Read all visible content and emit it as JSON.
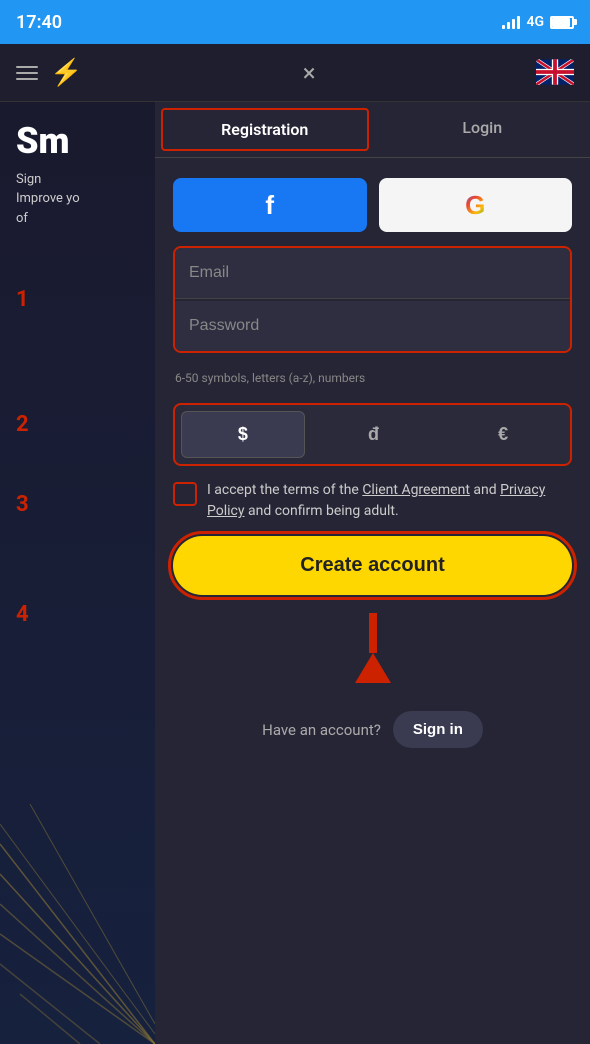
{
  "statusBar": {
    "time": "17:40",
    "network": "4G"
  },
  "navBar": {
    "closeLabel": "×"
  },
  "tabs": {
    "registration": "Registration",
    "login": "Login",
    "activeTab": "registration"
  },
  "social": {
    "facebookLabel": "f",
    "googleLabel": "G"
  },
  "form": {
    "emailPlaceholder": "Email",
    "passwordPlaceholder": "Password",
    "passwordHint": "6-50 symbols, letters (a-z), numbers"
  },
  "currencies": [
    {
      "symbol": "$",
      "active": true
    },
    {
      "symbol": "đ",
      "active": false
    },
    {
      "symbol": "€",
      "active": false
    }
  ],
  "terms": {
    "text1": "I accept the terms of the ",
    "link1": "Client Agreement",
    "text2": " and ",
    "link2": "Privacy Policy",
    "text3": " and confirm being adult."
  },
  "createButton": "Create account",
  "signIn": {
    "text": "Have an account?",
    "buttonLabel": "Sign in"
  },
  "steps": [
    "1",
    "2",
    "3",
    "4"
  ],
  "leftPanel": {
    "title": "Sm",
    "subtitle1": "Sign",
    "subtitle2": "Improve yo",
    "subtitle3": "of"
  }
}
